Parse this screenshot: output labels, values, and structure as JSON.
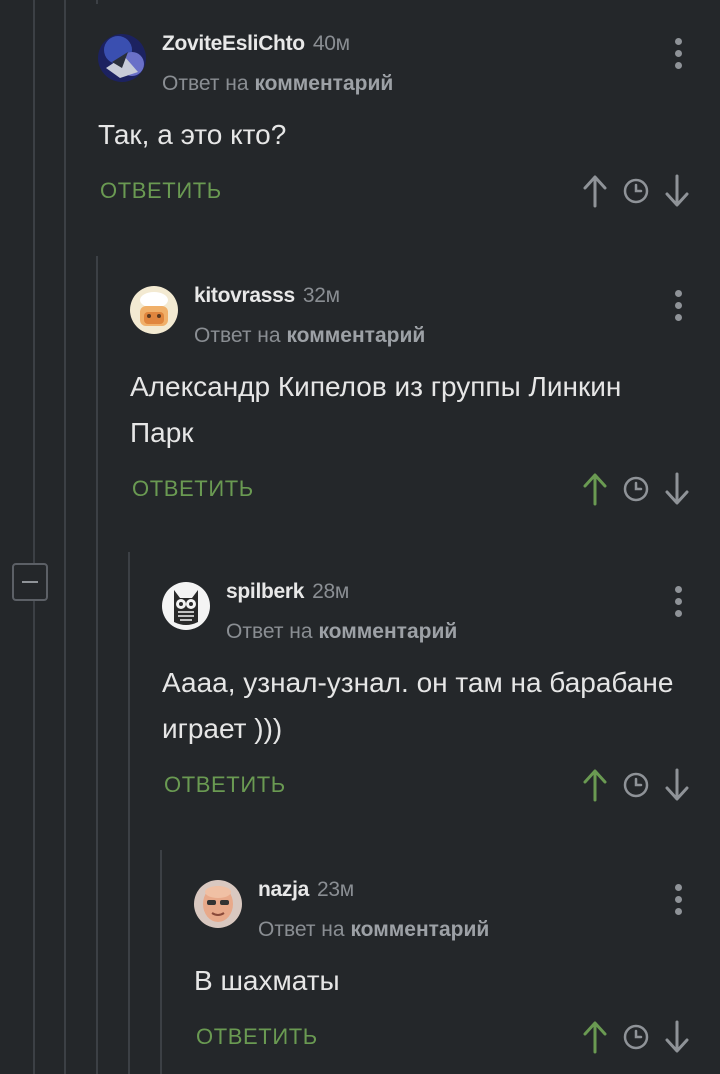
{
  "comments": [
    {
      "author": "ZoviteEsliChto",
      "time": "40м",
      "reply_prefix": "Ответ на",
      "reply_link": "комментарий",
      "text": "Так, а это кто?",
      "reply_label": "ОТВЕТИТЬ",
      "upvoted": false
    },
    {
      "author": "kitovrasss",
      "time": "32м",
      "reply_prefix": "Ответ на",
      "reply_link": "комментарий",
      "text": "Александр Кипелов из группы Линкин Парк",
      "reply_label": "ОТВЕТИТЬ",
      "upvoted": true
    },
    {
      "author": "spilberk",
      "time": "28м",
      "reply_prefix": "Ответ на",
      "reply_link": "комментарий",
      "text": "Аааа, узнал-узнал. он там на барабане играет )))",
      "reply_label": "ОТВЕТИТЬ",
      "upvoted": true
    },
    {
      "author": "nazja",
      "time": "23м",
      "reply_prefix": "Ответ на",
      "reply_link": "комментарий",
      "text": "В шахматы",
      "reply_label": "ОТВЕТИТЬ",
      "upvoted": true
    }
  ],
  "colors": {
    "background": "#24272a",
    "accent_green": "#6a9a52",
    "muted": "#8a8e93",
    "text": "#e6e6e6"
  },
  "icons": [
    "collapse-icon",
    "more-icon",
    "upvote-icon",
    "clock-icon",
    "downvote-icon"
  ]
}
